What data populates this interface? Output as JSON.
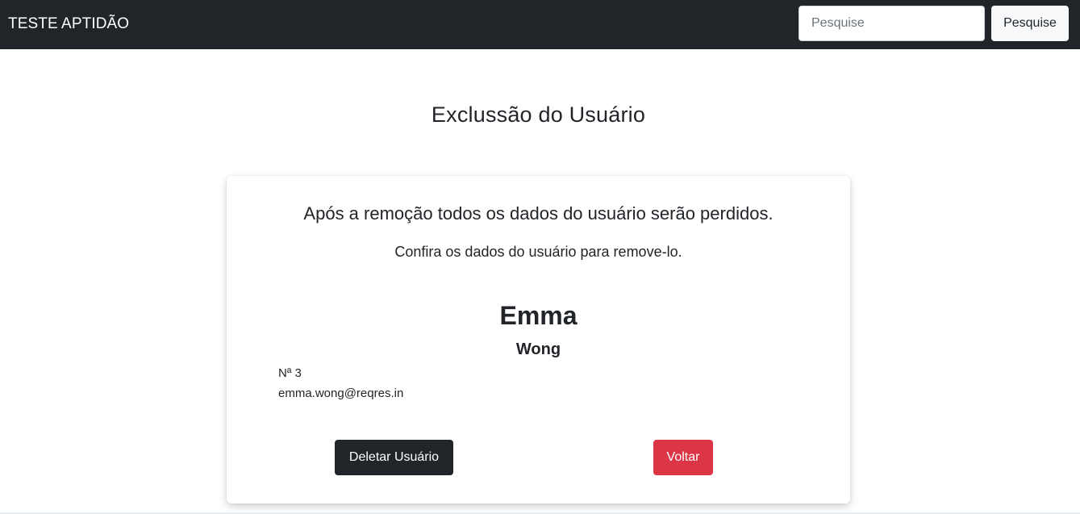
{
  "navbar": {
    "brand": "TESTE APTIDÃO",
    "search_placeholder": "Pesquise",
    "search_button": "Pesquise"
  },
  "main": {
    "title": "Exclussão do Usuário"
  },
  "card": {
    "warning": "Após a remoção todos os dados do usuário serão perdidos.",
    "confirm": "Confira os dados do usuário para remove-lo.",
    "first_name": "Emma",
    "last_name": "Wong",
    "user_id": "Nª 3",
    "email": "emma.wong@reqres.in",
    "delete_button": "Deletar Usuário",
    "back_button": "Voltar"
  },
  "colors": {
    "navbar": "#212529",
    "delete": "#212529",
    "back": "#dc3545"
  }
}
